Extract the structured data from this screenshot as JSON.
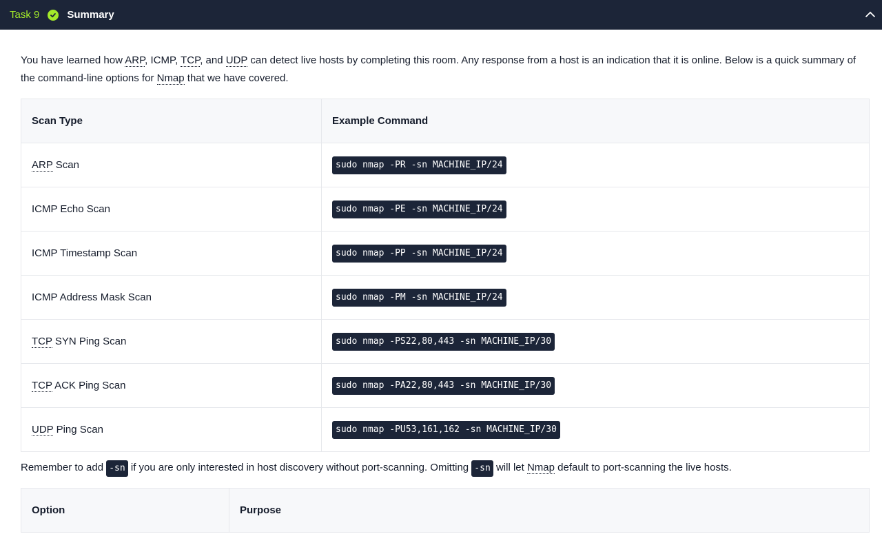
{
  "header": {
    "task_label": "Task 9",
    "title": "Summary"
  },
  "intro": {
    "t1": "You have learned how ",
    "arp": "ARP",
    "t2": ", ICMP, ",
    "tcp": "TCP",
    "t3": ", and ",
    "udp": "UDP",
    "t4": " can detect live hosts by completing this room. Any response from a host is an indication that it is online. Below is a quick summary of the command-line options for ",
    "nmap": "Nmap",
    "t5": " that we have covered."
  },
  "scan_table": {
    "headers": [
      "Scan Type",
      "Example Command"
    ],
    "rows": [
      {
        "abbr": "ARP",
        "rest": " Scan",
        "cmd": "sudo nmap -PR -sn MACHINE_IP/24"
      },
      {
        "abbr": "",
        "rest": "ICMP Echo Scan",
        "cmd": "sudo nmap -PE -sn MACHINE_IP/24"
      },
      {
        "abbr": "",
        "rest": "ICMP Timestamp Scan",
        "cmd": "sudo nmap -PP -sn MACHINE_IP/24"
      },
      {
        "abbr": "",
        "rest": "ICMP Address Mask Scan",
        "cmd": "sudo nmap -PM -sn MACHINE_IP/24"
      },
      {
        "abbr": "TCP",
        "rest": " SYN Ping Scan",
        "cmd": "sudo nmap -PS22,80,443 -sn MACHINE_IP/30"
      },
      {
        "abbr": "TCP",
        "rest": " ACK Ping Scan",
        "cmd": "sudo nmap -PA22,80,443 -sn MACHINE_IP/30"
      },
      {
        "abbr": "UDP",
        "rest": " Ping Scan",
        "cmd": "sudo nmap -PU53,161,162 -sn MACHINE_IP/30"
      }
    ]
  },
  "note": {
    "t1": "Remember to add ",
    "code1": "-sn",
    "t2": " if you are only interested in host discovery without port-scanning. Omitting ",
    "code2": "-sn",
    "t3": " will let ",
    "nmap": "Nmap",
    "t4": " default to port-scanning the live hosts."
  },
  "option_table": {
    "headers": [
      "Option",
      "Purpose"
    ]
  },
  "colors": {
    "header_bg": "#1c2538",
    "accent_green": "#a3ea2a",
    "code_bg": "#1c2538"
  },
  "icons": {
    "check": "check-circle-icon",
    "collapse": "chevron-up-icon"
  }
}
